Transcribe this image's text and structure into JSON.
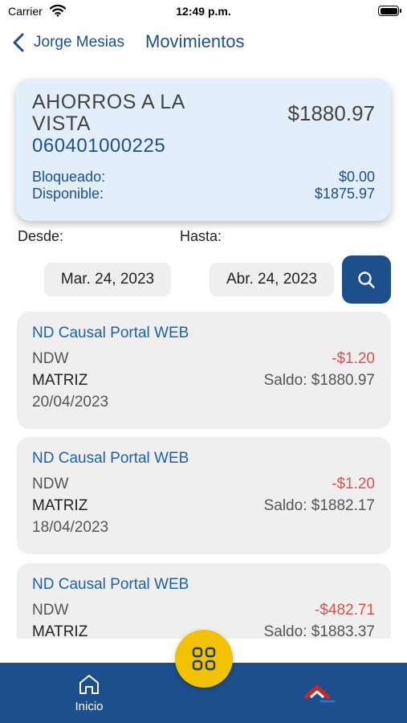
{
  "status_bar": {
    "carrier": "Carrier",
    "time": "12:49 p.m."
  },
  "nav": {
    "back_label": "Jorge Mesias",
    "title": "Movimientos"
  },
  "account": {
    "type": "AHORROS A LA VISTA",
    "number": "060401000225",
    "balance": "$1880.97",
    "blocked_label": "Bloqueado:",
    "blocked_value": "$0.00",
    "available_label": "Disponible:",
    "available_value": "$1875.97"
  },
  "filters": {
    "from_label": "Desde:",
    "to_label": "Hasta:",
    "from_value": "Mar. 24, 2023",
    "to_value": "Abr. 24, 2023"
  },
  "transactions": [
    {
      "title": "ND Causal Portal WEB",
      "code": "NDW",
      "amount": "-$1.20",
      "branch": "MATRIZ",
      "saldo": "Saldo: $1880.97",
      "date": "20/04/2023"
    },
    {
      "title": "ND Causal Portal WEB",
      "code": "NDW",
      "amount": "-$1.20",
      "branch": "MATRIZ",
      "saldo": "Saldo: $1882.17",
      "date": "18/04/2023"
    },
    {
      "title": "ND Causal Portal WEB",
      "code": "NDW",
      "amount": "-$482.71",
      "branch": "MATRIZ",
      "saldo": "Saldo: $1883.37",
      "date": ""
    }
  ],
  "tabbar": {
    "home_label": "Inicio"
  },
  "colors": {
    "brand_blue": "#1d4f8c",
    "accent_yellow": "#f2c200",
    "negative_red": "#d9534f",
    "card_blue": "#e2eef9"
  },
  "icons": {
    "back": "chevron-left-icon",
    "search": "search-icon",
    "home": "home-icon",
    "menu": "grid-icon",
    "logo": "bank-logo"
  }
}
